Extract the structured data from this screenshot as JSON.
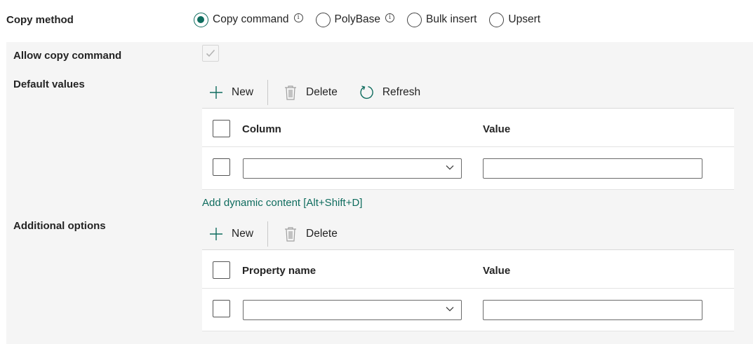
{
  "copy_method": {
    "label": "Copy method",
    "options": [
      {
        "label": "Copy command",
        "selected": true,
        "info": true
      },
      {
        "label": "PolyBase",
        "selected": false,
        "info": true
      },
      {
        "label": "Bulk insert",
        "selected": false,
        "info": false
      },
      {
        "label": "Upsert",
        "selected": false,
        "info": false
      }
    ],
    "info_glyph": "i"
  },
  "allow_copy_command": {
    "label": "Allow copy command",
    "checked": true,
    "disabled": true
  },
  "default_values": {
    "label": "Default values",
    "toolbar": {
      "new_label": "New",
      "delete_label": "Delete",
      "refresh_label": "Refresh"
    },
    "columns": [
      "Column",
      "Value"
    ],
    "rows": [
      {
        "column": "",
        "value": ""
      }
    ],
    "dynamic_link": "Add dynamic content [Alt+Shift+D]"
  },
  "additional_options": {
    "label": "Additional options",
    "toolbar": {
      "new_label": "New",
      "delete_label": "Delete"
    },
    "columns": [
      "Property name",
      "Value"
    ],
    "rows": [
      {
        "property": "",
        "value": ""
      }
    ]
  },
  "colors": {
    "accent": "#0f6c5e",
    "panel_bg": "#f5f5f5",
    "text": "#242424"
  },
  "icons": {
    "new": "plus-icon",
    "delete": "trash-icon",
    "refresh": "refresh-icon",
    "dropdown": "chevron-down-icon",
    "info": "info-icon",
    "check": "checkmark-icon"
  }
}
